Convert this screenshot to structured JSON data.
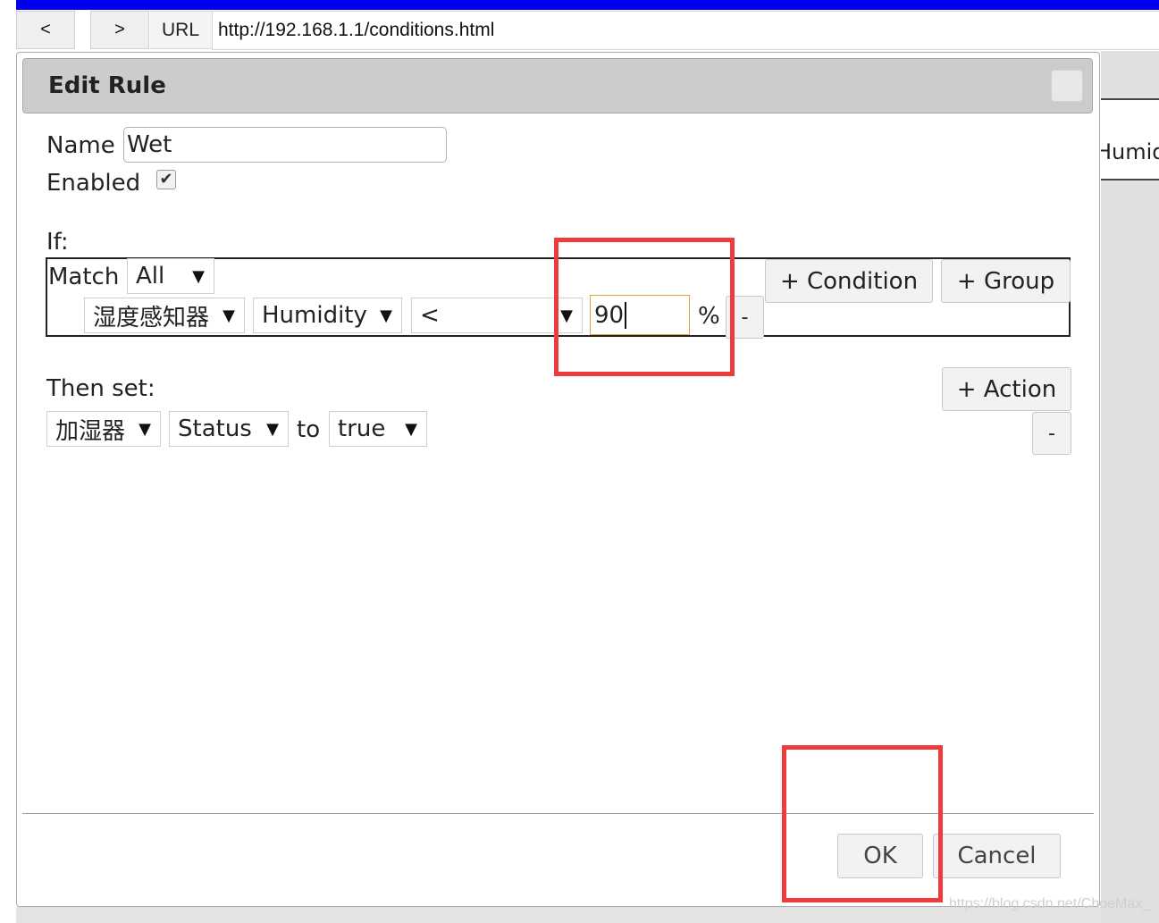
{
  "browser": {
    "back_label": "<",
    "forward_label": ">",
    "url_label": "URL",
    "url_value": "http://192.168.1.1/conditions.html"
  },
  "background": {
    "tab_text": "Humidity"
  },
  "dialog": {
    "title": "Edit Rule",
    "name_label": "Name",
    "name_value": "Wet",
    "enabled_label": "Enabled",
    "enabled_checked": true,
    "if_label": "If:",
    "match_label": "Match",
    "match_value": "All",
    "condition": {
      "device": "湿度感知器",
      "property": "Humidity",
      "operator": "<",
      "value": "90",
      "unit": "%",
      "remove_label": "-"
    },
    "add_condition_label": "+ Condition",
    "add_group_label": "+ Group",
    "then_label": "Then set:",
    "action": {
      "device": "加湿器",
      "property": "Status",
      "to_label": "to",
      "value": "true"
    },
    "add_action_label": "+ Action",
    "remove_action_label": "-",
    "ok_label": "OK",
    "cancel_label": "Cancel"
  },
  "watermark": "https://blog.csdn.net/ChoeMax_",
  "colors": {
    "highlight": "#ee3c3c",
    "browser_bar": "#0000ee",
    "input_focus": "#e8a13c"
  }
}
